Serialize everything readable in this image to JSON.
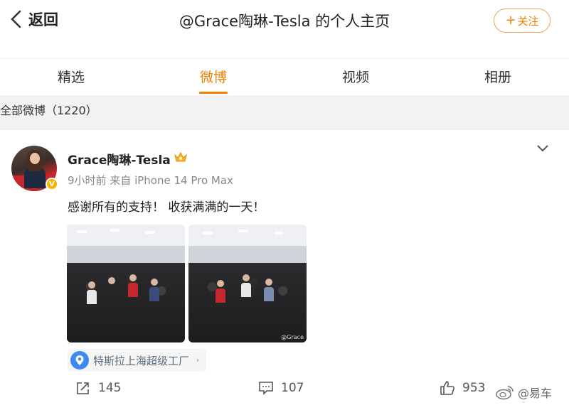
{
  "header": {
    "back_label": "返回",
    "title": "@Grace陶琳-Tesla 的个人主页",
    "follow_label": "关注",
    "follow_plus": "+"
  },
  "tabs": [
    {
      "label": "精选",
      "active": false
    },
    {
      "label": "微博",
      "active": true
    },
    {
      "label": "视频",
      "active": false
    },
    {
      "label": "相册",
      "active": false
    }
  ],
  "section": {
    "label": "全部微博（1220）"
  },
  "post": {
    "username": "Grace陶琳-Tesla",
    "verified_mark": "V",
    "meta": "9小时前 来自 iPhone 14 Pro Max",
    "text": "感谢所有的支持！ 收获满满的一天！",
    "photo_watermark": "@Grace",
    "location": "特斯拉上海超级工厂",
    "location_arrow": "›",
    "reposts": "145",
    "comments": "107",
    "likes": "953"
  },
  "watermark": {
    "label": "@易车"
  },
  "colors": {
    "accent": "#f08000",
    "location_icon": "#3d8bf2",
    "verified": "#f7b500"
  },
  "icons": [
    "chevron-left-icon",
    "plus-icon",
    "vip-crown-icon",
    "chevron-down-icon",
    "location-pin-icon",
    "repost-icon",
    "comment-icon",
    "like-icon",
    "weibo-logo-icon"
  ]
}
